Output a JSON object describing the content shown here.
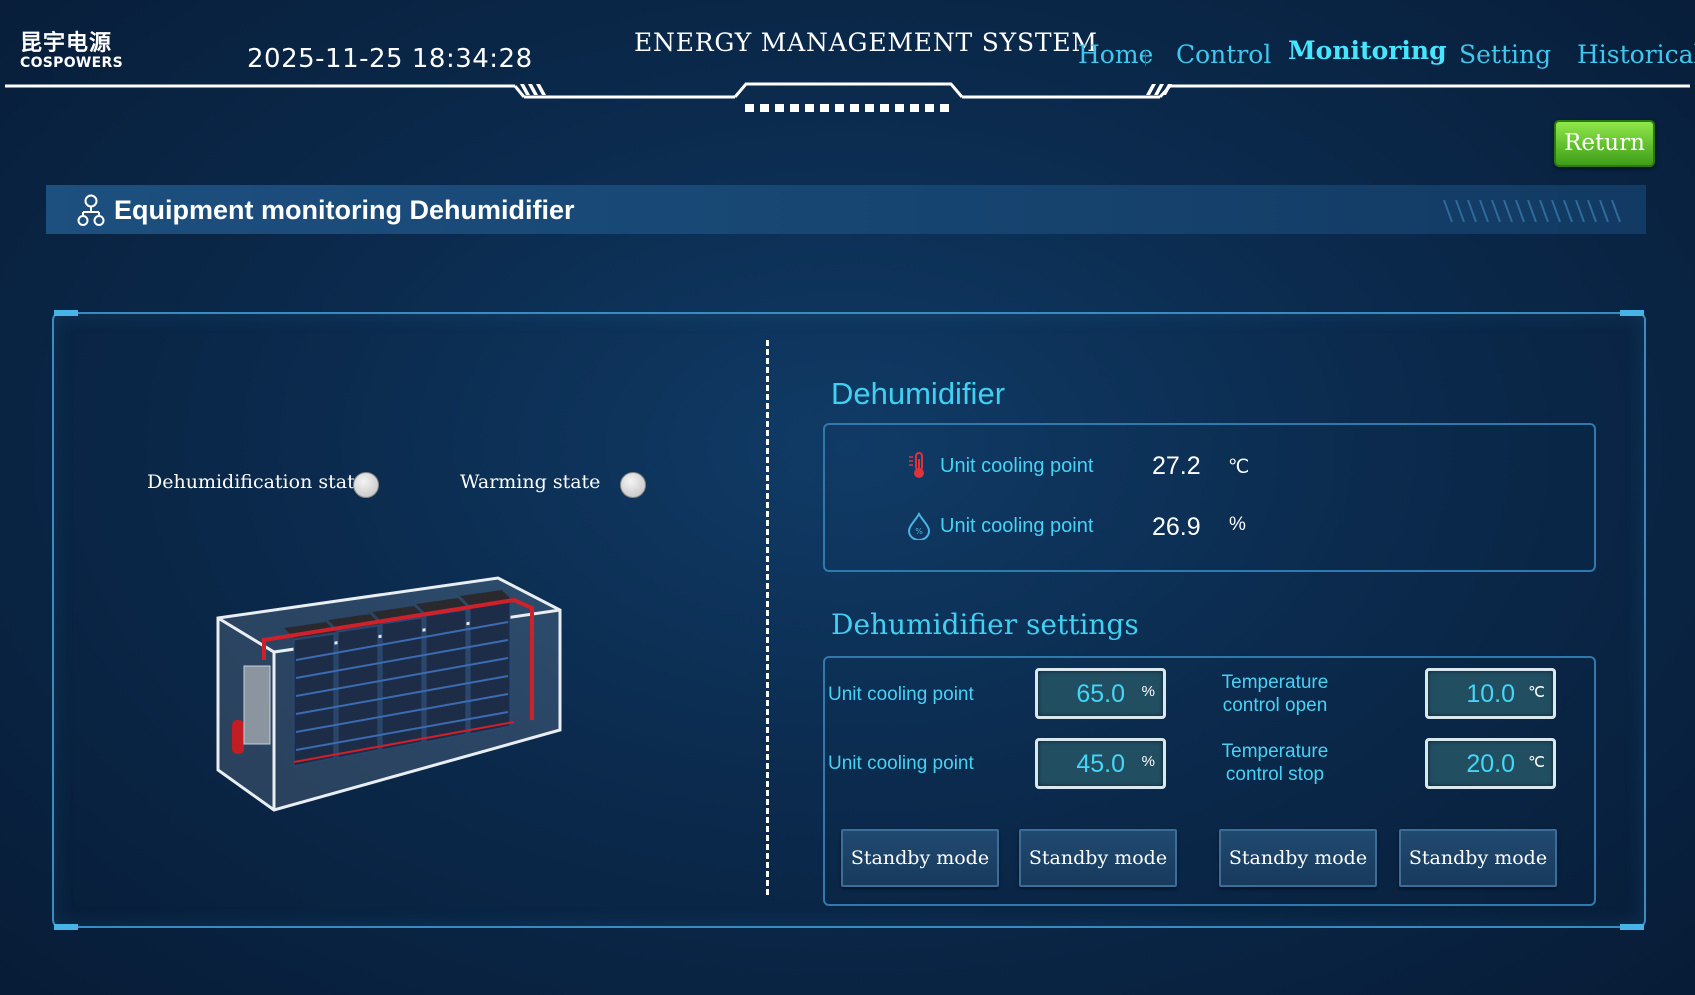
{
  "header": {
    "logo_cn": "昆宇电源",
    "logo_en": "COSPOWERS",
    "datetime": "2025-11-25 18:34:28",
    "system_title": "ENERGY MANAGEMENT SYSTEM",
    "nav": [
      {
        "label": "Home",
        "active": false
      },
      {
        "label": "Control",
        "active": false
      },
      {
        "label": "Monitoring",
        "active": true
      },
      {
        "label": "Setting",
        "active": false
      },
      {
        "label": "Historical",
        "active": false
      }
    ]
  },
  "return_label": "Return",
  "section_title": "Equipment monitoring Dehumidifier",
  "states": [
    {
      "label": "Dehumidification state",
      "on": false
    },
    {
      "label": "Warming state",
      "on": false
    }
  ],
  "dehumidifier": {
    "title": "Dehumidifier",
    "readings": [
      {
        "label": "Unit cooling point",
        "value": "27.2",
        "unit": "℃",
        "icon": "thermometer-icon"
      },
      {
        "label": "Unit cooling point",
        "value": "26.9",
        "unit": "%",
        "icon": "humidity-drop-icon"
      }
    ]
  },
  "settings": {
    "title": "Dehumidifier settings",
    "left": [
      {
        "label": "Unit cooling point",
        "value": "65.0",
        "unit": "%"
      },
      {
        "label": "Unit cooling point",
        "value": "45.0",
        "unit": "%"
      }
    ],
    "right": [
      {
        "label_line1": "Temperature",
        "label_line2": "control open",
        "value": "10.0",
        "unit": "℃"
      },
      {
        "label_line1": "Temperature",
        "label_line2": "control stop",
        "value": "20.0",
        "unit": "℃"
      }
    ],
    "buttons": [
      "Standby mode",
      "Standby mode",
      "Standby mode",
      "Standby mode"
    ]
  },
  "colors": {
    "accent": "#3fd0f2",
    "return_green": "#5cc62a",
    "led_off": "#d0d0d0"
  }
}
